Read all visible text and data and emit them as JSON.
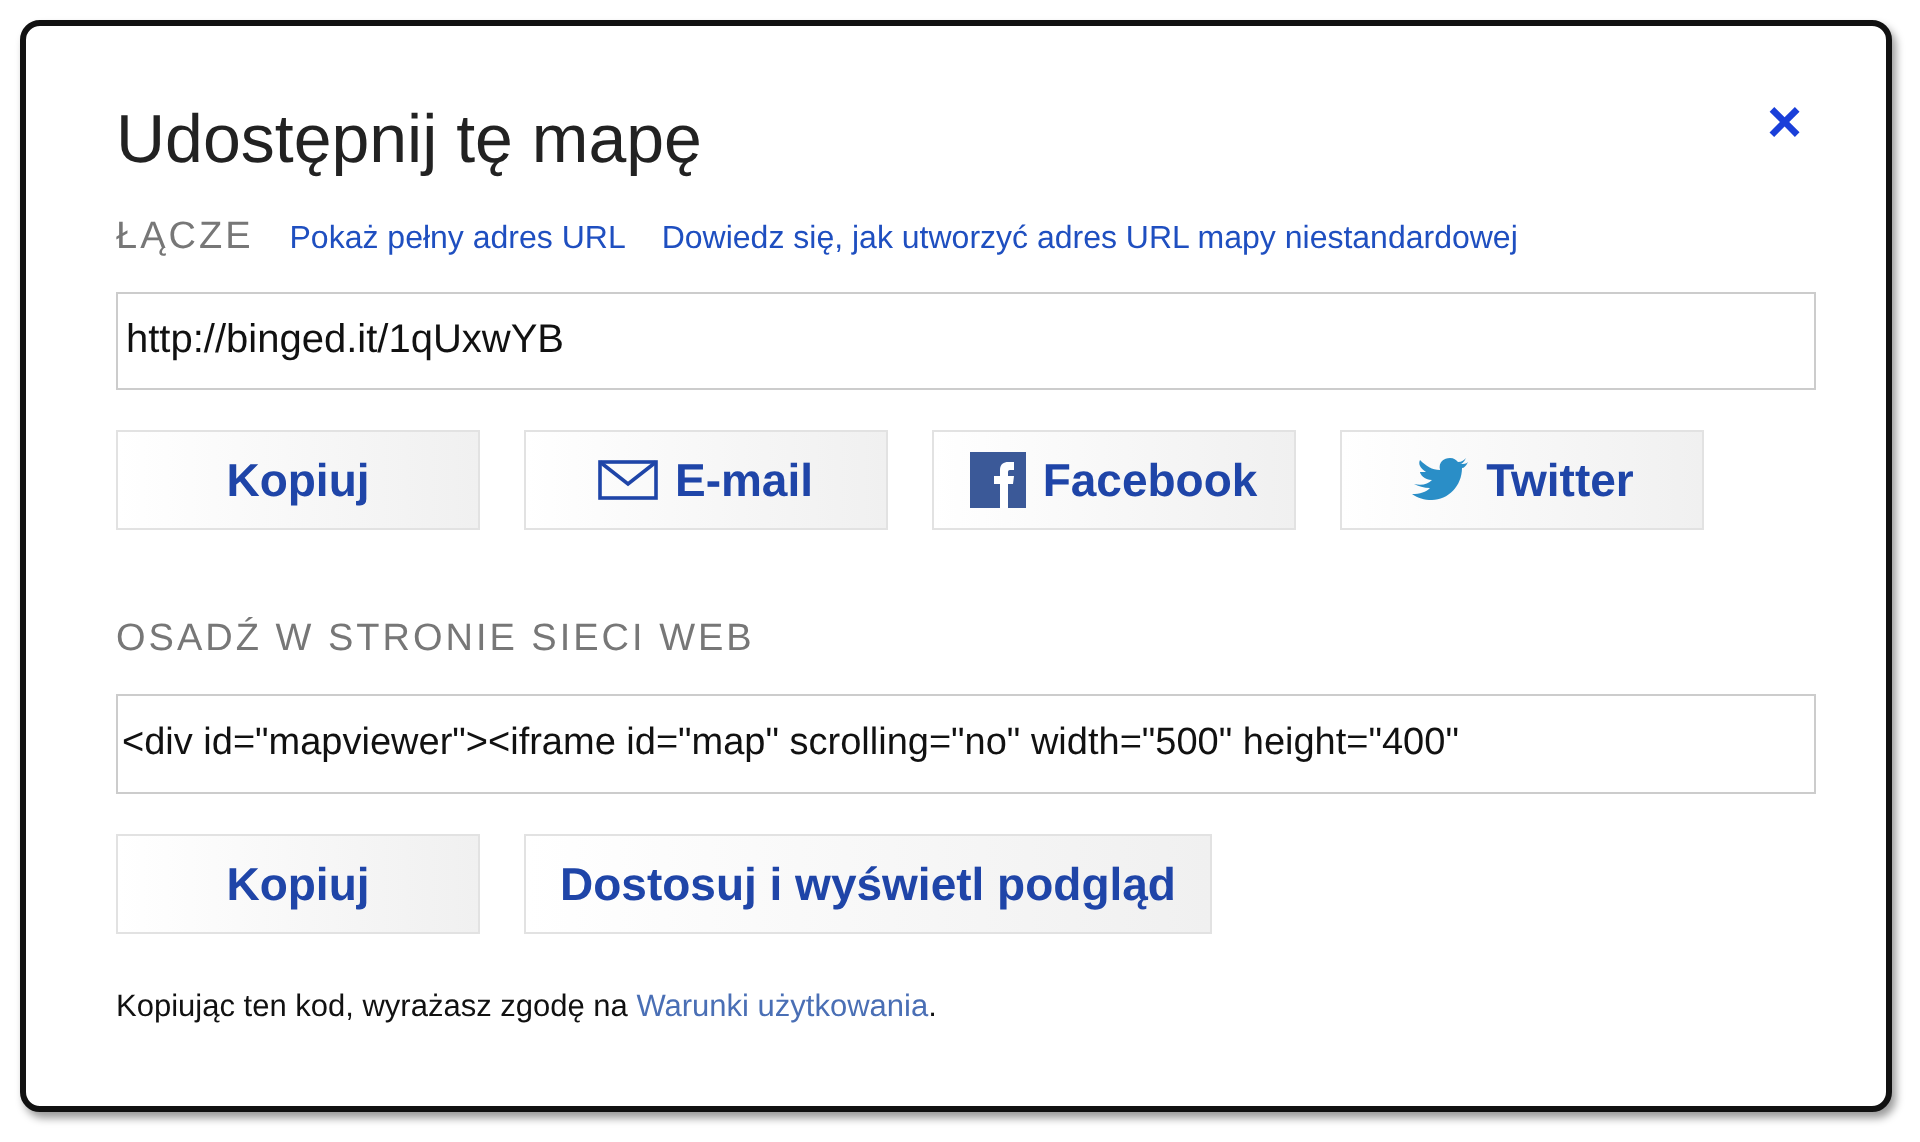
{
  "dialog": {
    "title": "Udostępnij tę mapę",
    "close": "×"
  },
  "link_section": {
    "label": "ŁĄCZE",
    "links": [
      "Pokaż pełny adres URL",
      "Dowiedz się, jak utworzyć adres URL mapy niestandardowej"
    ],
    "value": "http://binged.it/1qUxwYB",
    "buttons": [
      {
        "kind": "copy",
        "label": "Kopiuj"
      },
      {
        "kind": "email",
        "label": "E-mail"
      },
      {
        "kind": "facebook",
        "label": "Facebook"
      },
      {
        "kind": "twitter",
        "label": "Twitter"
      }
    ]
  },
  "embed_section": {
    "label": "OSADŹ W STRONIE SIECI WEB",
    "value": "<div id=\"mapviewer\"><iframe id=\"map\" scrolling=\"no\" width=\"500\" height=\"400\"",
    "buttons": [
      {
        "kind": "copy",
        "label": "Kopiuj"
      },
      {
        "kind": "preview",
        "label": "Dostosuj i wyświetl podgląd"
      }
    ]
  },
  "terms": {
    "text": "Kopiując ten kod, wyrażasz zgodę na ",
    "link": "Warunki użytkowania",
    "end": "."
  }
}
